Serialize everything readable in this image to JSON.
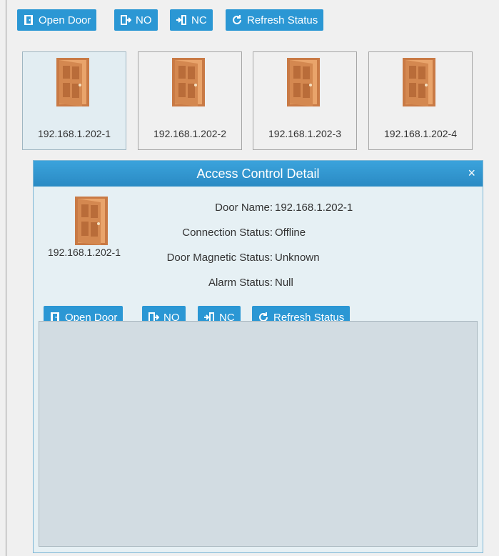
{
  "toolbar": {
    "open_door": "Open Door",
    "no": "NO",
    "nc": "NC",
    "refresh": "Refresh Status"
  },
  "doors": [
    {
      "name": "192.168.1.202-1"
    },
    {
      "name": "192.168.1.202-2"
    },
    {
      "name": "192.168.1.202-3"
    },
    {
      "name": "192.168.1.202-4"
    }
  ],
  "detail": {
    "title": "Access Control Detail",
    "close": "×",
    "door_label": "192.168.1.202-1",
    "fields": {
      "door_name_key": "Door Name:",
      "door_name_val": "192.168.1.202-1",
      "connection_key": "Connection Status:",
      "connection_val": "Offline",
      "magnetic_key": "Door Magnetic Status:",
      "magnetic_val": "Unknown",
      "alarm_key": "Alarm Status:",
      "alarm_val": "Null"
    },
    "toolbar": {
      "open_door": "Open Door",
      "no": "NO",
      "nc": "NC",
      "refresh": "Refresh Status"
    }
  },
  "colors": {
    "button_bg": "#2b97d4",
    "dialog_header": "#2a8ac3",
    "door_wood": "#d58a52"
  }
}
